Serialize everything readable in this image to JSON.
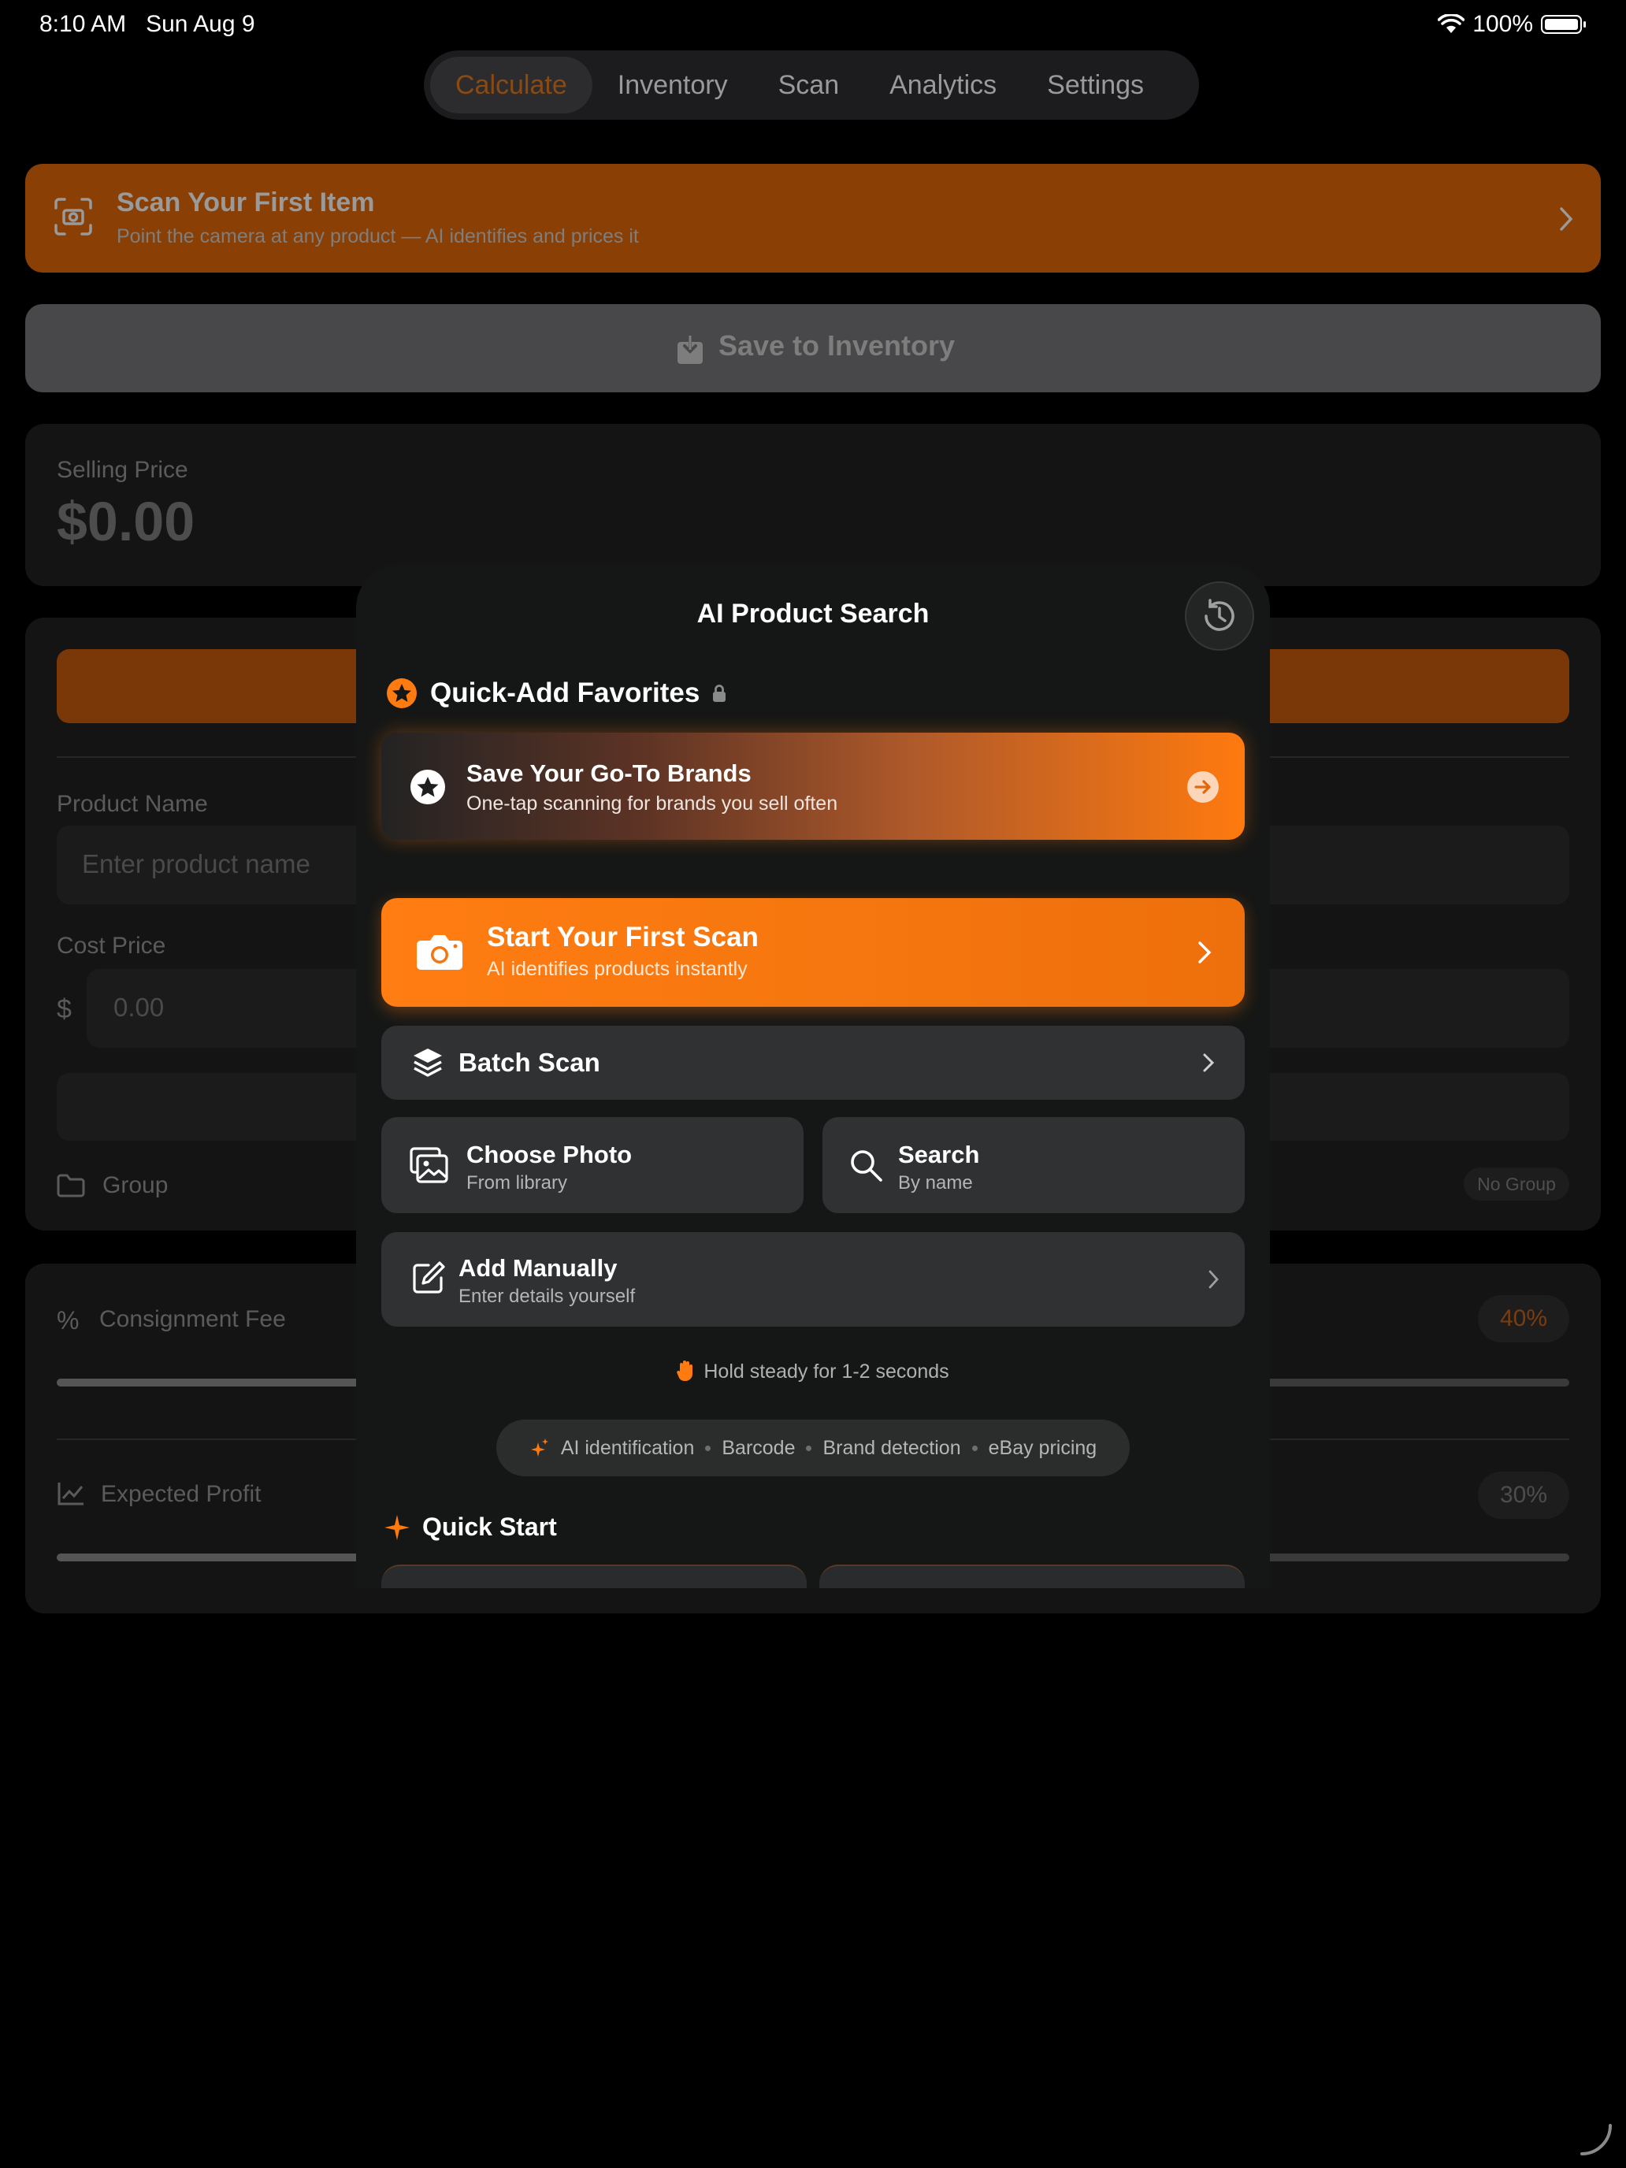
{
  "status": {
    "time": "8:10 AM",
    "date": "Sun Aug 9",
    "battery": "100%"
  },
  "tabs": [
    {
      "label": "Calculate",
      "active": true
    },
    {
      "label": "Inventory"
    },
    {
      "label": "Scan"
    },
    {
      "label": "Analytics"
    },
    {
      "label": "Settings"
    }
  ],
  "background": {
    "banner": {
      "title": "Scan Your First Item",
      "subtitle": "Point the camera at any product — AI identifies and prices it"
    },
    "save_inventory": "Save to Inventory",
    "selling_price": {
      "label": "Selling Price",
      "value": "$0.00"
    },
    "product_name": {
      "label": "Product Name",
      "placeholder": "Enter product name"
    },
    "cost_price": {
      "label": "Cost Price",
      "currency": "$",
      "placeholder": "0.00"
    },
    "group": {
      "label": "Group",
      "value": "No Group"
    },
    "consignment_fee": {
      "label": "Consignment Fee",
      "value": "40%",
      "fraction": 0.4
    },
    "expected_profit": {
      "label": "Expected Profit",
      "value": "30%",
      "fraction": 0.3
    }
  },
  "modal": {
    "title": "AI Product Search",
    "quick_add": {
      "title": "Quick-Add Favorites",
      "card_title": "Save Your Go-To Brands",
      "card_subtitle": "One-tap scanning for brands you sell often"
    },
    "start_scan": {
      "title": "Start Your First Scan",
      "subtitle": "AI identifies products instantly"
    },
    "batch_scan": "Batch Scan",
    "choose_photo": {
      "title": "Choose Photo",
      "subtitle": "From library"
    },
    "search": {
      "title": "Search",
      "subtitle": "By name"
    },
    "add_manually": {
      "title": "Add Manually",
      "subtitle": "Enter details yourself"
    },
    "hint": "Hold steady for 1-2 seconds",
    "features": [
      "AI identification",
      "Barcode",
      "Brand detection",
      "eBay pricing"
    ],
    "quick_start": "Quick Start"
  },
  "colors": {
    "accent": "#FF7A0F",
    "background": "#000000",
    "modal": "#151716"
  }
}
